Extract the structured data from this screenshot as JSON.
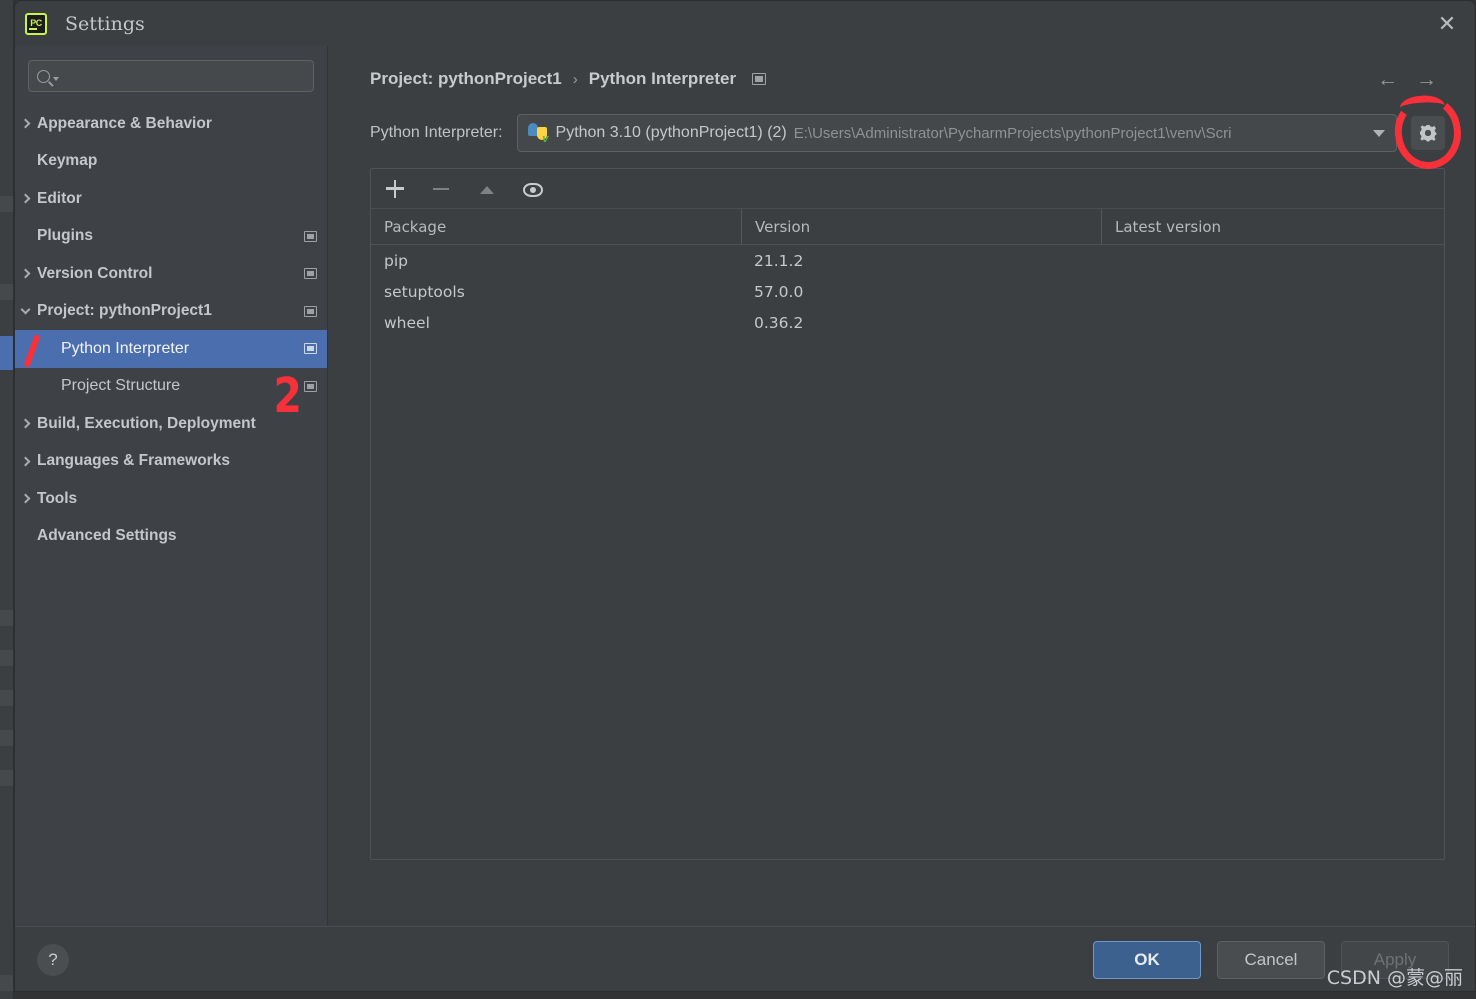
{
  "window": {
    "title": "Settings",
    "app_icon": "pycharm-icon",
    "close_icon": "close-icon"
  },
  "sidebar": {
    "search": {
      "value": "",
      "placeholder": "",
      "icon": "search-icon"
    },
    "items": [
      {
        "label": "Appearance & Behavior",
        "expandable": true,
        "expanded": false,
        "child": false,
        "badge": false,
        "selected": false
      },
      {
        "label": "Keymap",
        "expandable": false,
        "expanded": false,
        "child": false,
        "badge": false,
        "selected": false
      },
      {
        "label": "Editor",
        "expandable": true,
        "expanded": false,
        "child": false,
        "badge": false,
        "selected": false
      },
      {
        "label": "Plugins",
        "expandable": false,
        "expanded": false,
        "child": false,
        "badge": true,
        "selected": false
      },
      {
        "label": "Version Control",
        "expandable": true,
        "expanded": false,
        "child": false,
        "badge": true,
        "selected": false
      },
      {
        "label": "Project: pythonProject1",
        "expandable": true,
        "expanded": true,
        "child": false,
        "badge": true,
        "selected": false
      },
      {
        "label": "Python Interpreter",
        "expandable": false,
        "expanded": false,
        "child": true,
        "badge": true,
        "selected": true
      },
      {
        "label": "Project Structure",
        "expandable": false,
        "expanded": false,
        "child": true,
        "badge": true,
        "selected": false
      },
      {
        "label": "Build, Execution, Deployment",
        "expandable": true,
        "expanded": false,
        "child": false,
        "badge": false,
        "selected": false
      },
      {
        "label": "Languages & Frameworks",
        "expandable": true,
        "expanded": false,
        "child": false,
        "badge": false,
        "selected": false
      },
      {
        "label": "Tools",
        "expandable": true,
        "expanded": false,
        "child": false,
        "badge": false,
        "selected": false
      },
      {
        "label": "Advanced Settings",
        "expandable": false,
        "expanded": false,
        "child": false,
        "badge": false,
        "selected": false
      }
    ]
  },
  "breadcrumb": {
    "parent": "Project: pythonProject1",
    "separator": "›",
    "current": "Python Interpreter",
    "badge_icon": "project-scope-icon"
  },
  "nav": {
    "back_icon": "arrow-left-icon",
    "back_glyph": "←",
    "forward_icon": "arrow-right-icon",
    "forward_glyph": "→"
  },
  "interpreter": {
    "label": "Python Interpreter:",
    "icon": "python-venv-icon",
    "name": "Python 3.10 (pythonProject1) (2)",
    "path": "E:\\Users\\Administrator\\PycharmProjects\\pythonProject1\\venv\\Scri",
    "caret_icon": "chevron-down-icon",
    "gear_icon": "gear-icon"
  },
  "packages": {
    "toolbar": [
      {
        "icon": "add-package-icon",
        "enabled": true
      },
      {
        "icon": "remove-package-icon",
        "enabled": false
      },
      {
        "icon": "upgrade-package-icon",
        "enabled": false
      },
      {
        "icon": "show-early-releases-icon",
        "enabled": true
      }
    ],
    "columns": [
      "Package",
      "Version",
      "Latest version"
    ],
    "rows": [
      {
        "package": "pip",
        "version": "21.1.2",
        "latest": ""
      },
      {
        "package": "setuptools",
        "version": "57.0.0",
        "latest": ""
      },
      {
        "package": "wheel",
        "version": "0.36.2",
        "latest": ""
      }
    ]
  },
  "footer": {
    "help_icon": "help-icon",
    "help_glyph": "?",
    "ok": "OK",
    "cancel": "Cancel",
    "apply": "Apply"
  },
  "annotations": {
    "mark_one": "1",
    "mark_two": "2",
    "circle": "red-circle-highlight"
  },
  "watermark": "CSDN @蒙@丽",
  "colors": {
    "accent_blue": "#4b6eaf",
    "primary_button": "#3c618f",
    "annotation_red": "#f8303a",
    "panel_bg": "#3c3f41",
    "sidebar_bg": "#3e4246"
  }
}
